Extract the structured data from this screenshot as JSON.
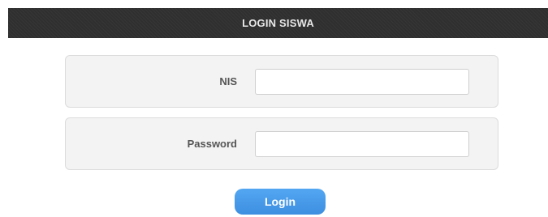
{
  "header": {
    "title": "LOGIN SISWA"
  },
  "form": {
    "nis_label": "NIS",
    "nis_value": "",
    "password_label": "Password",
    "password_value": "",
    "login_label": "Login"
  },
  "colors": {
    "header_bg": "#2f2f2f",
    "button_bg": "#4a9eea",
    "row_bg": "#f3f3f3"
  }
}
